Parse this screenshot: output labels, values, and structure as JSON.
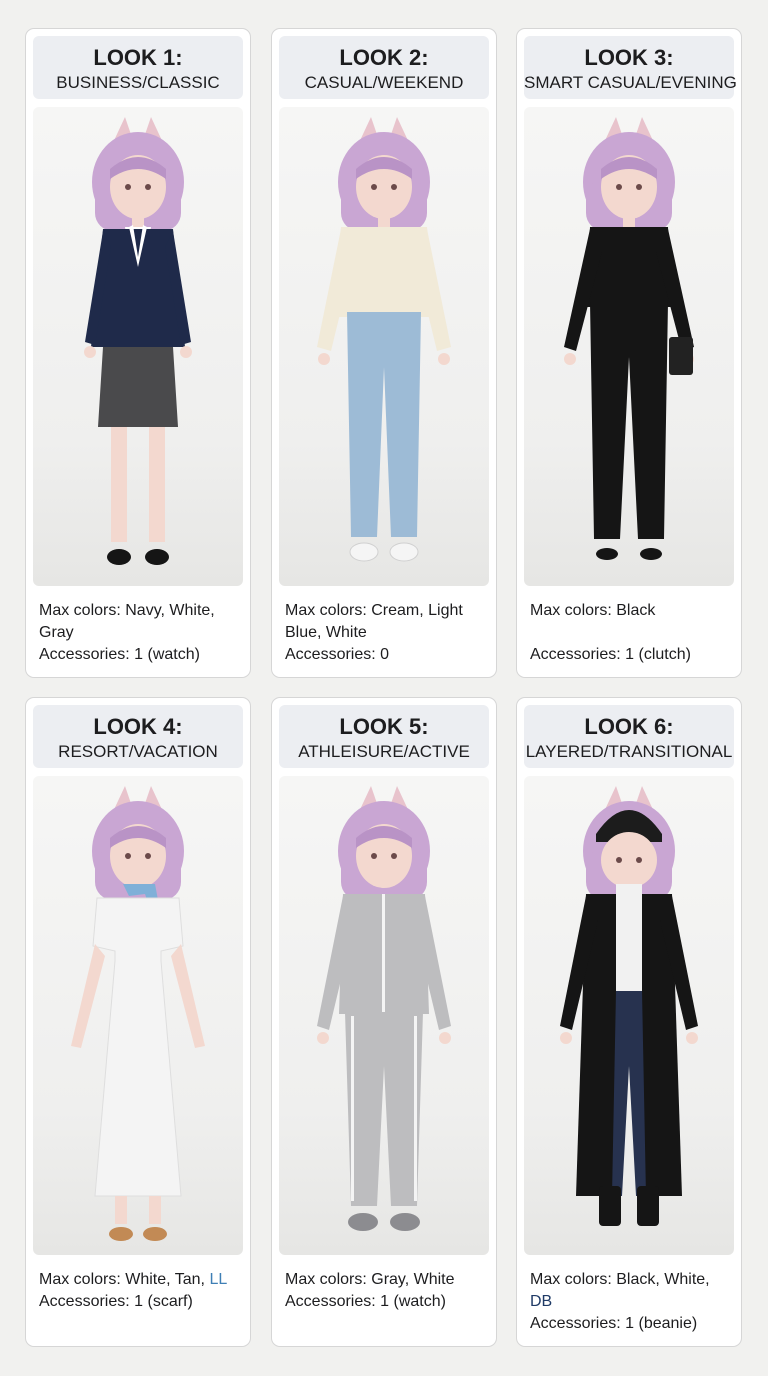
{
  "looks": [
    {
      "title": "LOOK 1:",
      "style": "BUSINESS/CLASSIC",
      "colors_label": "Max colors: Navy, White,",
      "colors_label2": "Gray",
      "accessories": "Accessories: 1 (watch)"
    },
    {
      "title": "LOOK 2:",
      "style": "CASUAL/WEEKEND",
      "colors_label": "Max colors: Cream, Light",
      "colors_label2": "Blue, White",
      "accessories": "Accessories: 0"
    },
    {
      "title": "LOOK 3:",
      "style": "SMART CASUAL/EVENING",
      "colors_label": "Max colors: Black",
      "colors_label2": "",
      "accessories": "Accessories: 1 (clutch)"
    },
    {
      "title": "LOOK 4:",
      "style": "RESORT/VACATION",
      "colors_label": "Max colors: White, Tan, ",
      "colors_extra": "LL",
      "accessories": "Accessories: 1 (scarf)"
    },
    {
      "title": "LOOK 5:",
      "style": "ATHLEISURE/ACTIVE",
      "colors_label": "Max colors: Gray, White",
      "accessories": "Accessories: 1 (watch)"
    },
    {
      "title": "LOOK 6:",
      "style": "LAYERED/TRANSITIONAL",
      "colors_label": "Max colors: Black, White, ",
      "colors_extra": "DB",
      "accessories": "Accessories: 1 (beanie)"
    }
  ],
  "colors": {
    "hair": "#c9a6d3",
    "skin": "#f3d8cf",
    "navy": "#1f2a4a",
    "gray": "#4a4a4c",
    "cream": "#f1ead8",
    "denim_light": "#9dbbd6",
    "black": "#151515",
    "white_dress": "#f4f4f4",
    "track_gray": "#bdbdbf",
    "denim_dark": "#27324f"
  }
}
